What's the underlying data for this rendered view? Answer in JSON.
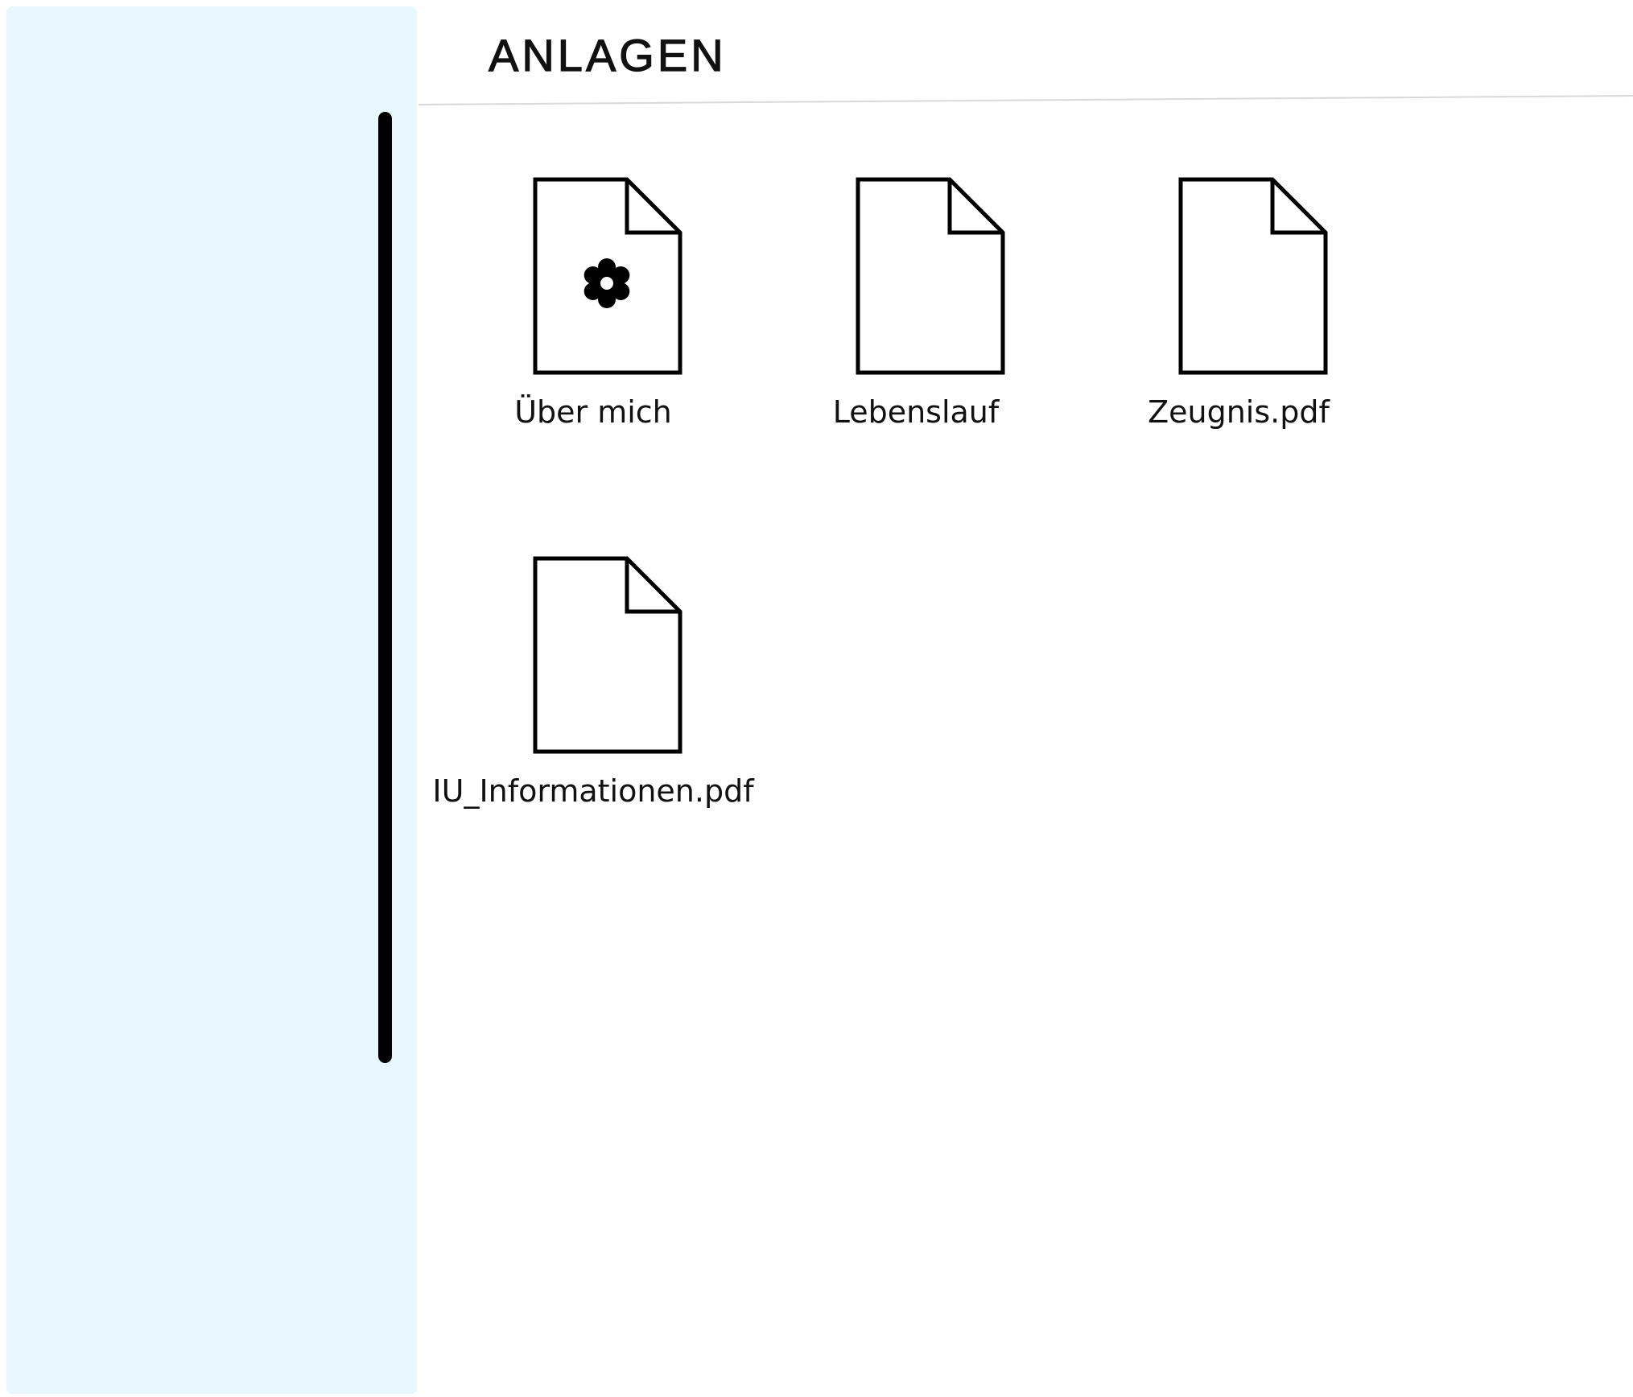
{
  "window": {
    "title": "ANLAGEN"
  },
  "files": [
    {
      "name": "Über mich",
      "icon": "document-flower-icon"
    },
    {
      "name": "Lebenslauf",
      "icon": "document-icon"
    },
    {
      "name": "Zeugnis.pdf",
      "icon": "document-icon"
    },
    {
      "name": "IU_Informationen.pdf",
      "icon": "document-icon"
    }
  ],
  "colors": {
    "sidebar_background": "#e8f6fe",
    "scrollbar": "#000000",
    "icon_stroke": "#000000",
    "divider": "#d9d9d9"
  }
}
